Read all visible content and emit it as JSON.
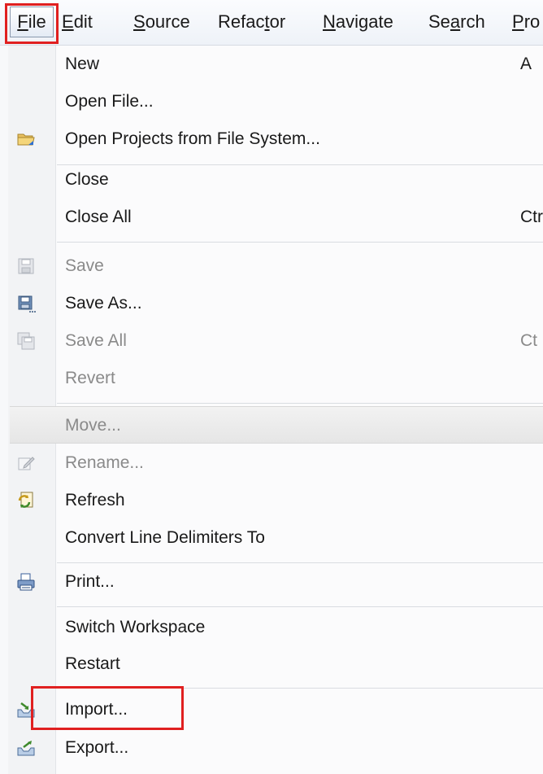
{
  "menubar": {
    "items": [
      {
        "label": "File",
        "mnemonic_before": "",
        "mnemonic": "F",
        "mnemonic_after": "ile"
      },
      {
        "label": "Edit",
        "mnemonic_before": "",
        "mnemonic": "E",
        "mnemonic_after": "dit"
      },
      {
        "label": "Source",
        "mnemonic_before": "",
        "mnemonic": "S",
        "mnemonic_after": "ource"
      },
      {
        "label": "Refactor",
        "mnemonic_before": "Refac",
        "mnemonic": "t",
        "mnemonic_after": "or"
      },
      {
        "label": "Navigate",
        "mnemonic_before": "",
        "mnemonic": "N",
        "mnemonic_after": "avigate"
      },
      {
        "label": "Search",
        "mnemonic_before": "Se",
        "mnemonic": "a",
        "mnemonic_after": "rch"
      },
      {
        "label": "Project",
        "mnemonic_before": "",
        "mnemonic": "P",
        "mnemonic_after": "ro"
      }
    ]
  },
  "file_menu": {
    "items": {
      "new": {
        "label": "New",
        "shortcut": "A"
      },
      "open_file": {
        "label": "Open File..."
      },
      "open_projects": {
        "label": "Open Projects from File System..."
      },
      "close": {
        "label": "Close"
      },
      "close_all": {
        "label": "Close All",
        "shortcut": "Ctr"
      },
      "save": {
        "label": "Save"
      },
      "save_as": {
        "label": "Save As..."
      },
      "save_all": {
        "label": "Save All",
        "shortcut": "Ct"
      },
      "revert": {
        "label": "Revert"
      },
      "move": {
        "label": "Move..."
      },
      "rename": {
        "label": "Rename..."
      },
      "refresh": {
        "label": "Refresh"
      },
      "convert_line_delimiters": {
        "label": "Convert Line Delimiters To"
      },
      "print": {
        "label": "Print..."
      },
      "switch_workspace": {
        "label": "Switch Workspace"
      },
      "restart": {
        "label": "Restart"
      },
      "import": {
        "label": "Import..."
      },
      "export": {
        "label": "Export..."
      }
    }
  },
  "colors": {
    "highlight": "#e02020",
    "disabled_text": "#8a8a8a",
    "text": "#1a1a1a"
  },
  "icons": {
    "open_projects": "folder-icon",
    "save": "save-icon",
    "save_as": "save-as-icon",
    "save_all": "save-all-icon",
    "rename": "rename-icon",
    "refresh": "refresh-icon",
    "print": "print-icon",
    "import": "import-icon",
    "export": "export-icon"
  }
}
